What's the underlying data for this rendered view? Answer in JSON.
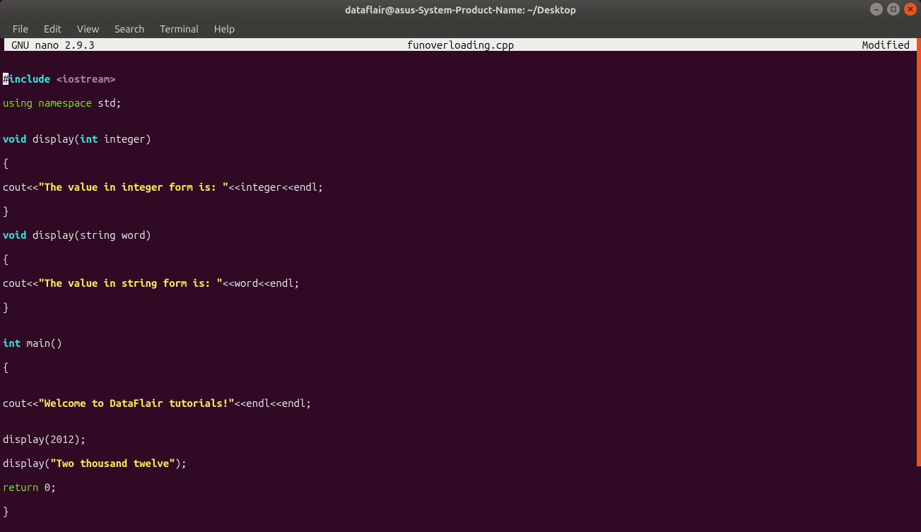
{
  "titlebar": {
    "text": "dataflair@asus-System-Product-Name: ~/Desktop"
  },
  "menubar": {
    "items": [
      "File",
      "Edit",
      "View",
      "Search",
      "Terminal",
      "Help"
    ]
  },
  "nano": {
    "app": "GNU nano 2.9.3",
    "filename": "funoverloading.cpp",
    "status": "Modified"
  },
  "code": {
    "l01a": "#",
    "l01b": "include",
    "l01c": " ",
    "l01d": "<iostream>",
    "l02a": "using",
    "l02b": " ",
    "l02c": "namespace",
    "l02d": " std;",
    "l03": "",
    "l04a": "void",
    "l04b": " display(",
    "l04c": "int",
    "l04d": " integer)",
    "l05": "{",
    "l06a": "cout<<",
    "l06b": "\"The value in integer form is: \"",
    "l06c": "<<integer<<endl;",
    "l07": "}",
    "l08a": "void",
    "l08b": " display(string word)",
    "l09": "{",
    "l10a": "cout<<",
    "l10b": "\"The value in string form is: \"",
    "l10c": "<<word<<endl;",
    "l11": "}",
    "l12": "",
    "l13a": "int",
    "l13b": " main()",
    "l14": "{",
    "l15": "",
    "l16a": "cout<<",
    "l16b": "\"Welcome to DataFlair tutorials!\"",
    "l16c": "<<endl<<endl;",
    "l17": "",
    "l18": "display(2012);",
    "l19a": "display(",
    "l19b": "\"Two thousand twelve\"",
    "l19c": ");",
    "l20a": "return",
    "l20b": " 0;",
    "l21": "}"
  }
}
